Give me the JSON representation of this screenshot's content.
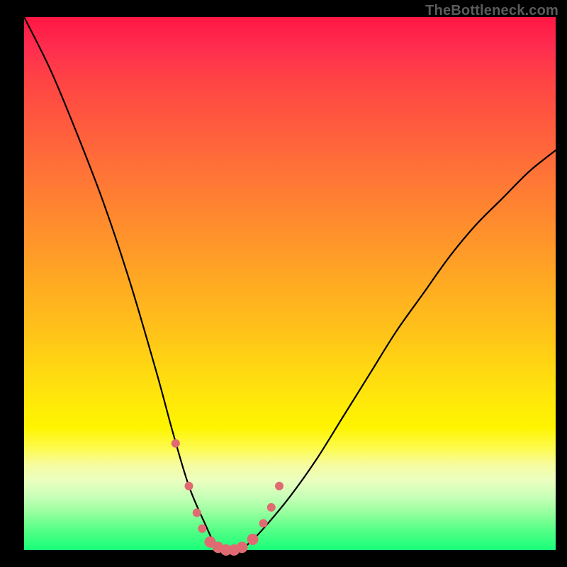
{
  "watermark": "TheBottleneck.com",
  "chart_data": {
    "type": "line",
    "title": "",
    "xlabel": "",
    "ylabel": "",
    "xlim": [
      0,
      100
    ],
    "ylim": [
      0,
      100
    ],
    "description": "V-shaped bottleneck curve on a red-to-green vertical gradient background. The curve minimum (optimal, green zone) is near x≈38; both left and right arms rise steeply into the red zone.",
    "series": [
      {
        "name": "bottleneck-curve",
        "x": [
          0,
          5,
          10,
          15,
          20,
          25,
          28,
          31,
          34,
          36,
          38,
          40,
          42,
          45,
          50,
          55,
          60,
          65,
          70,
          75,
          80,
          85,
          90,
          95,
          100
        ],
        "values": [
          100,
          90,
          78,
          65,
          50,
          33,
          22,
          12,
          5,
          1,
          0,
          0,
          1,
          4,
          10,
          17,
          25,
          33,
          41,
          48,
          55,
          61,
          66,
          71,
          75
        ]
      }
    ],
    "markers": {
      "color": "#e06a72",
      "radius_small": 6,
      "radius_large": 8,
      "points": [
        {
          "x": 28.5,
          "y": 20
        },
        {
          "x": 31,
          "y": 12
        },
        {
          "x": 32.5,
          "y": 7
        },
        {
          "x": 33.5,
          "y": 4
        },
        {
          "x": 35,
          "y": 1.5
        },
        {
          "x": 36.5,
          "y": 0.5
        },
        {
          "x": 38,
          "y": 0
        },
        {
          "x": 39.5,
          "y": 0
        },
        {
          "x": 41,
          "y": 0.5
        },
        {
          "x": 43,
          "y": 2
        },
        {
          "x": 45,
          "y": 5
        },
        {
          "x": 46.5,
          "y": 8
        },
        {
          "x": 48,
          "y": 12
        }
      ]
    },
    "gradient_stops": [
      {
        "pos": 0,
        "color": "#ff1744"
      },
      {
        "pos": 50,
        "color": "#ffb020"
      },
      {
        "pos": 78,
        "color": "#fff400"
      },
      {
        "pos": 100,
        "color": "#18ff78"
      }
    ]
  }
}
